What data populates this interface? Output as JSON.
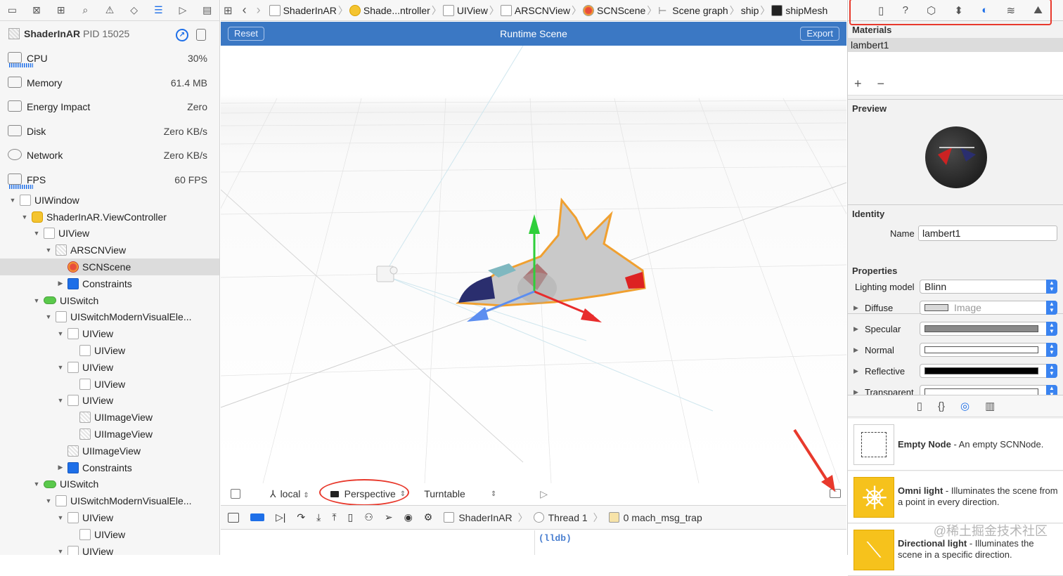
{
  "left_panel": {
    "process": {
      "name": "ShaderInAR",
      "pid": "PID 15025"
    },
    "gauges": [
      {
        "label": "CPU",
        "value": "30%"
      },
      {
        "label": "Memory",
        "value": "61.4 MB"
      },
      {
        "label": "Energy Impact",
        "value": "Zero"
      },
      {
        "label": "Disk",
        "value": "Zero KB/s"
      },
      {
        "label": "Network",
        "value": "Zero KB/s"
      },
      {
        "label": "FPS",
        "value": "60 FPS"
      }
    ],
    "tree": [
      {
        "label": "UIWindow",
        "indent": 0,
        "open": true,
        "icon": "plain"
      },
      {
        "label": "ShaderInAR.ViewController",
        "indent": 1,
        "open": true,
        "icon": "yellow"
      },
      {
        "label": "UIView",
        "indent": 2,
        "open": true,
        "icon": "plain"
      },
      {
        "label": "ARSCNView",
        "indent": 3,
        "open": true,
        "icon": "img"
      },
      {
        "label": "SCNScene",
        "indent": 4,
        "open": null,
        "icon": "scn",
        "selected": true
      },
      {
        "label": "Constraints",
        "indent": 4,
        "open": false,
        "icon": "blue"
      },
      {
        "label": "UISwitch",
        "indent": 2,
        "open": true,
        "icon": "toggle"
      },
      {
        "label": "UISwitchModernVisualEle...",
        "indent": 3,
        "open": true,
        "icon": "plain"
      },
      {
        "label": "UIView",
        "indent": 4,
        "open": true,
        "icon": "plain"
      },
      {
        "label": "UIView",
        "indent": 5,
        "open": null,
        "icon": "plain"
      },
      {
        "label": "UIView",
        "indent": 4,
        "open": true,
        "icon": "plain"
      },
      {
        "label": "UIView",
        "indent": 5,
        "open": null,
        "icon": "plain"
      },
      {
        "label": "UIView",
        "indent": 4,
        "open": true,
        "icon": "plain"
      },
      {
        "label": "UIImageView",
        "indent": 5,
        "open": null,
        "icon": "img"
      },
      {
        "label": "UIImageView",
        "indent": 5,
        "open": null,
        "icon": "img"
      },
      {
        "label": "UIImageView",
        "indent": 4,
        "open": null,
        "icon": "img"
      },
      {
        "label": "Constraints",
        "indent": 4,
        "open": false,
        "icon": "blue"
      },
      {
        "label": "UISwitch",
        "indent": 2,
        "open": true,
        "icon": "toggle"
      },
      {
        "label": "UISwitchModernVisualEle...",
        "indent": 3,
        "open": true,
        "icon": "plain"
      },
      {
        "label": "UIView",
        "indent": 4,
        "open": true,
        "icon": "plain"
      },
      {
        "label": "UIView",
        "indent": 5,
        "open": null,
        "icon": "plain"
      },
      {
        "label": "UIView",
        "indent": 4,
        "open": true,
        "icon": "plain"
      }
    ]
  },
  "jumpbar": {
    "crumbs": [
      {
        "label": "ShaderInAR",
        "icon": "plain"
      },
      {
        "label": "Shade...ntroller",
        "icon": "yellow"
      },
      {
        "label": "UIView",
        "icon": "plain"
      },
      {
        "label": "ARSCNView",
        "icon": "plain"
      },
      {
        "label": "SCNScene",
        "icon": "scn"
      },
      {
        "label": "Scene graph",
        "icon": "graph"
      },
      {
        "label": "ship",
        "icon": "none"
      },
      {
        "label": "shipMesh",
        "icon": "dark"
      }
    ]
  },
  "scene": {
    "title": "Runtime Scene",
    "reset_label": "Reset",
    "export_label": "Export",
    "coord_label": "local",
    "camera_label": "Perspective",
    "mode_label": "Turntable"
  },
  "debug": {
    "crumbs": [
      "ShaderInAR",
      "Thread 1",
      "0 mach_msg_trap"
    ],
    "console_prompt": "(lldb)"
  },
  "inspector": {
    "materials_header": "Materials",
    "material_selected": "lambert1",
    "preview_header": "Preview",
    "identity_header": "Identity",
    "name_label": "Name",
    "name_value": "lambert1",
    "properties_header": "Properties",
    "lighting_label": "Lighting model",
    "lighting_value": "Blinn",
    "props": [
      {
        "label": "Diffuse",
        "value": "Image",
        "swatch": "#d8d8d8"
      },
      {
        "label": "Specular",
        "value": "",
        "swatch": "#8a8a8a"
      },
      {
        "label": "Normal",
        "value": "",
        "swatch": "#ffffff"
      },
      {
        "label": "Reflective",
        "value": "",
        "swatch": "#000000"
      },
      {
        "label": "Transparent",
        "value": "",
        "swatch": "#ffffff"
      }
    ]
  },
  "library": [
    {
      "title": "Empty Node",
      "desc": " - An empty SCNNode.",
      "thumb": "empty"
    },
    {
      "title": "Omni light",
      "desc": " - Illuminates the scene from a point in every direction.",
      "thumb": "sun"
    },
    {
      "title": "Directional light",
      "desc": " - Illuminates the scene in a specific direction.",
      "thumb": "dir"
    }
  ],
  "watermark": "@稀土掘金技术社区",
  "colors": {
    "accent": "#1e6fe8",
    "header_blue": "#3b78c4",
    "annotation_red": "#e8392c"
  }
}
